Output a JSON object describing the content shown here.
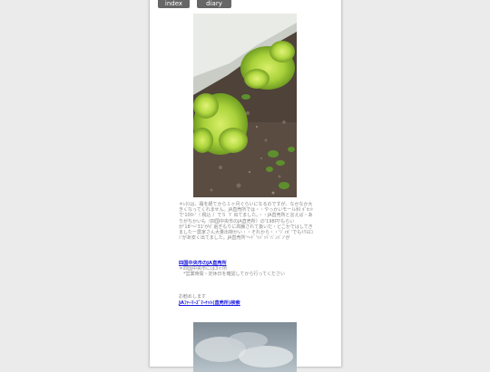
{
  "nav": {
    "index_label": "index",
    "diary_index_label": "diary index"
  },
  "entry": {
    "photo1_alt": "レタスの写真",
    "body_text": "＊ﾚﾀｽは、霜を経てから１ヶ月ぐらいになるのですが、なかなか大きくなってくれません。JA直売所では・・やっかいモール科 ﾎﾟｶｯﾄで'100-'（ 税込 ）で５ ７ 出てました。・・JA直売所と言えば・ありがちかいも（四国中央市のJA直売所）の'198円'もらいが'18'～'31'がﾎﾟ過ぎもりに高騰されて扱いだ・どこかではしてきましたー農家さん大量出荷かい・・それから・・'ｼﾞｬｶﾞ'でもﾄｳﾓﾛｺｼ'があ安く出てました。JA直売所'～ﾄﾞ'ｩﾊﾞｯﾄﾞﾊﾞﾝﾊﾞﾝ'が",
    "link1_label": "四国中央市のJA直売所",
    "note1": "＊四国中央市には3ヶ所",
    "note2": "　*営業時間・定休日を確認してから行ってください",
    "small_label": "お勧めします",
    "link2_label": "JAﾌｧｰﾏｰｽﾞﾏｰｹｯﾄ(直売所)検索",
    "photo2_alt": "空の写真"
  }
}
